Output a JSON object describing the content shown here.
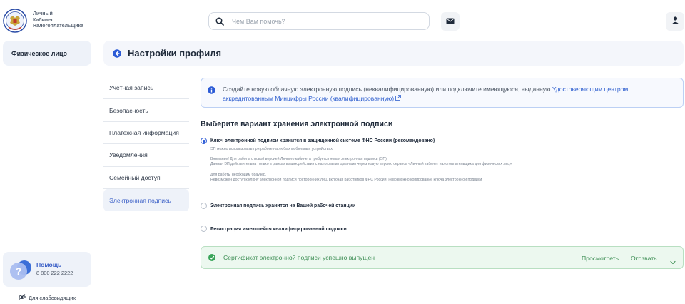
{
  "header": {
    "logo_lines": [
      "Личный",
      "Кабинет",
      "Налогоплательщика"
    ],
    "search_placeholder": "Чем Вам помочь?"
  },
  "sidebar": {
    "person_type": "Физическое лицо",
    "help": {
      "title": "Помощь",
      "phone": "8 800 222 2222"
    },
    "visually_impaired": "Для слабовидящих"
  },
  "page": {
    "title": "Настройки профиля"
  },
  "menu": {
    "items": [
      {
        "label": "Учётная запись"
      },
      {
        "label": "Безопасность"
      },
      {
        "label": "Платежная информация"
      },
      {
        "label": "Уведомления"
      },
      {
        "label": "Семейный доступ"
      },
      {
        "label": "Электронная подпись"
      }
    ],
    "active_index": 5
  },
  "info": {
    "text_line1": "Создайте новую облачную электронную подпись (неквалифицированную) или подключите имеющуюся, выданную",
    "link_part1": "Удостоверяющим центром, аккредитованным",
    "link_part2": "Минцифры России (квалифицированную)"
  },
  "storage": {
    "title": "Выберите вариант хранения электронной подписи",
    "options": [
      {
        "label": "Ключ электронной подписи хранится в защищенной системе ФНС России (рекомендовано)",
        "checked": true,
        "desc": [
          "ЭП можно использовать при работе на любых мобильных устройствах",
          "",
          "Внимание! Для работы с новой версией Личного кабинета требуется новая электронная подпись (ЭП).",
          "Данная ЭП действительна только в рамках взаимодействия с налоговыми органами через новую версию сервиса «Личный кабинет налогоплательщика для физических лиц»",
          "",
          "Для работы необходим браузер.",
          "Невозможен доступ к ключу электронной подписи посторонних лиц, включая работников ФНС России, невозможно копирование ключа электронной подписи"
        ]
      },
      {
        "label": "Электронная подпись хранится на Вашей рабочей станции",
        "checked": false
      },
      {
        "label": "Регистрация имеющейся квалифицированной подписи",
        "checked": false
      }
    ]
  },
  "certificate": {
    "message": "Сертификат электронной подписи успешно выпущен",
    "view_label": "Просмотреть",
    "revoke_label": "Отозвать"
  },
  "colors": {
    "accent": "#2c5bd6",
    "success": "#3f8f56",
    "panel": "#eef2f9"
  }
}
